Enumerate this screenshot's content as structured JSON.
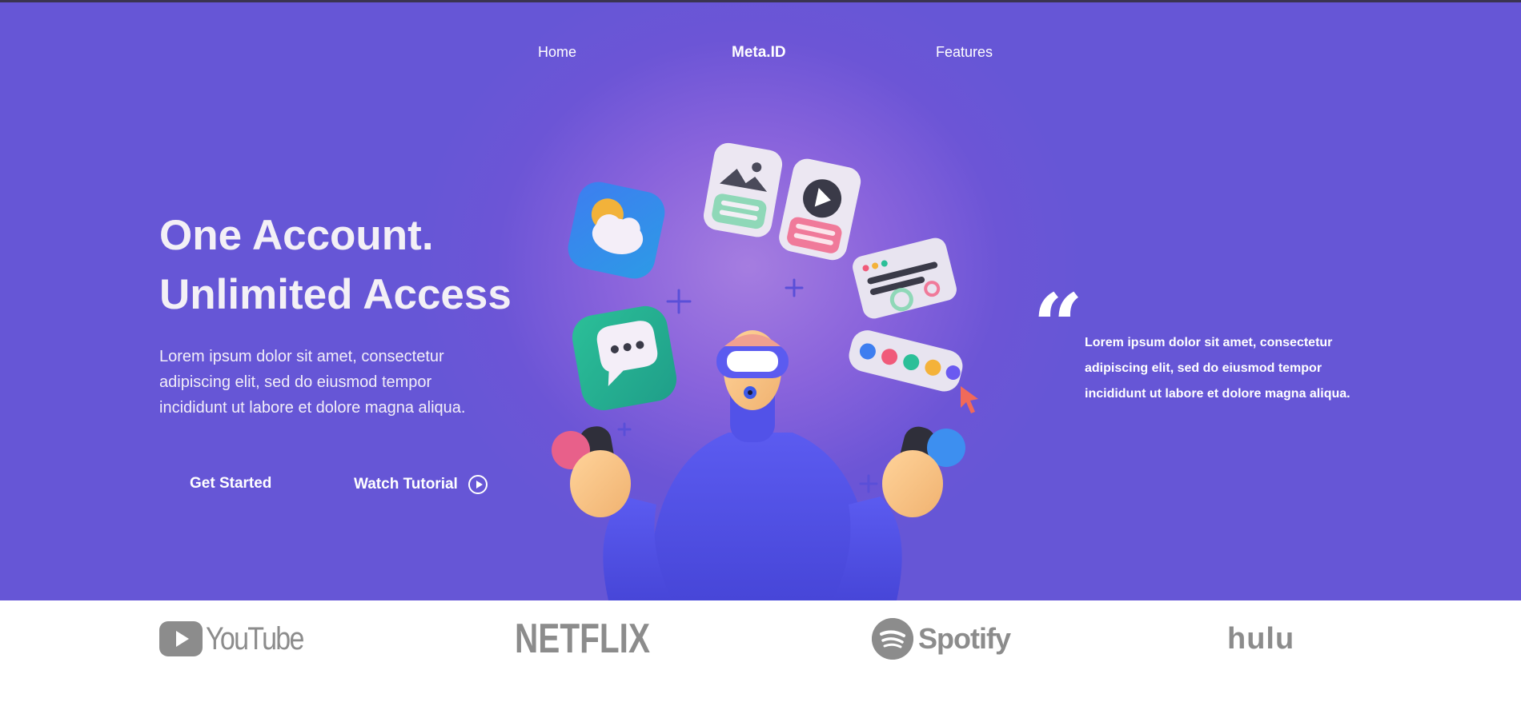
{
  "nav": {
    "home_label": "Home",
    "brand_label": "Meta.ID",
    "features_label": "Features"
  },
  "hero": {
    "title_line1": "One Account.",
    "title_line2": "Unlimited Access",
    "lead": "Lorem ipsum dolor sit amet, consectetur adipiscing elit, sed do eiusmod tempor incididunt ut labore et dolore magna aliqua.",
    "get_started_label": "Get Started",
    "watch_tutorial_label": "Watch Tutorial",
    "watch_tutorial_icon": "play-circle-icon"
  },
  "quote": {
    "mark": "“",
    "text": "Lorem ipsum dolor sit amet, consectetur adipiscing elit, sed do eiusmod tempor incididunt ut labore et dolore magna aliqua."
  },
  "illustration": {
    "subject": "vr-person-with-app-icons"
  },
  "partners": {
    "youtube": "YouTube",
    "netflix": "NETFLIX",
    "spotify": "Spotify",
    "hulu": "hulu"
  },
  "colors": {
    "hero_bg": "#6656d6",
    "hero_glow": "#a57de0",
    "text": "#ffffff",
    "logo_gray": "#8c8c8c"
  }
}
